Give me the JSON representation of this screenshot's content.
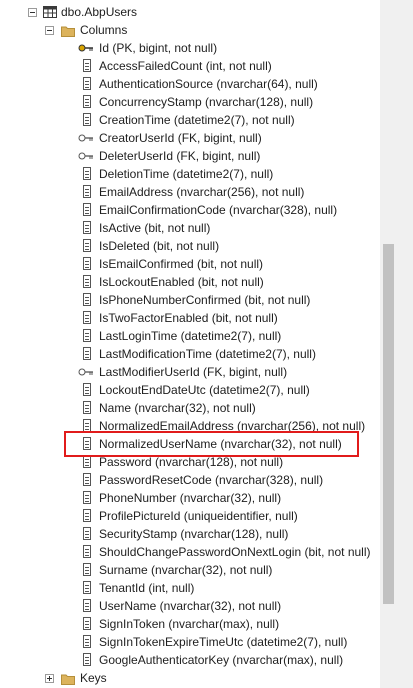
{
  "table": {
    "label": "dbo.AbpUsers",
    "icon": "table-icon"
  },
  "columns_folder": {
    "label": "Columns",
    "icon": "folder-icon"
  },
  "keys_folder": {
    "label": "Keys",
    "icon": "folder-icon"
  },
  "columns": [
    {
      "label": "Id (PK, bigint, not null)",
      "icon": "primary-key-icon"
    },
    {
      "label": "AccessFailedCount (int, not null)",
      "icon": "column-icon"
    },
    {
      "label": "AuthenticationSource (nvarchar(64), null)",
      "icon": "column-icon"
    },
    {
      "label": "ConcurrencyStamp (nvarchar(128), null)",
      "icon": "column-icon"
    },
    {
      "label": "CreationTime (datetime2(7), not null)",
      "icon": "column-icon"
    },
    {
      "label": "CreatorUserId (FK, bigint, null)",
      "icon": "foreign-key-icon"
    },
    {
      "label": "DeleterUserId (FK, bigint, null)",
      "icon": "foreign-key-icon"
    },
    {
      "label": "DeletionTime (datetime2(7), null)",
      "icon": "column-icon"
    },
    {
      "label": "EmailAddress (nvarchar(256), not null)",
      "icon": "column-icon"
    },
    {
      "label": "EmailConfirmationCode (nvarchar(328), null)",
      "icon": "column-icon"
    },
    {
      "label": "IsActive (bit, not null)",
      "icon": "column-icon"
    },
    {
      "label": "IsDeleted (bit, not null)",
      "icon": "column-icon"
    },
    {
      "label": "IsEmailConfirmed (bit, not null)",
      "icon": "column-icon"
    },
    {
      "label": "IsLockoutEnabled (bit, not null)",
      "icon": "column-icon"
    },
    {
      "label": "IsPhoneNumberConfirmed (bit, not null)",
      "icon": "column-icon"
    },
    {
      "label": "IsTwoFactorEnabled (bit, not null)",
      "icon": "column-icon"
    },
    {
      "label": "LastLoginTime (datetime2(7), null)",
      "icon": "column-icon"
    },
    {
      "label": "LastModificationTime (datetime2(7), null)",
      "icon": "column-icon"
    },
    {
      "label": "LastModifierUserId (FK, bigint, null)",
      "icon": "foreign-key-icon"
    },
    {
      "label": "LockoutEndDateUtc (datetime2(7), null)",
      "icon": "column-icon"
    },
    {
      "label": "Name (nvarchar(32), not null)",
      "icon": "column-icon"
    },
    {
      "label": "NormalizedEmailAddress (nvarchar(256), not null)",
      "icon": "column-icon"
    },
    {
      "label": "NormalizedUserName (nvarchar(32), not null)",
      "icon": "column-icon",
      "highlighted": true
    },
    {
      "label": "Password (nvarchar(128), not null)",
      "icon": "column-icon"
    },
    {
      "label": "PasswordResetCode (nvarchar(328), null)",
      "icon": "column-icon"
    },
    {
      "label": "PhoneNumber (nvarchar(32), null)",
      "icon": "column-icon"
    },
    {
      "label": "ProfilePictureId (uniqueidentifier, null)",
      "icon": "column-icon"
    },
    {
      "label": "SecurityStamp (nvarchar(128), null)",
      "icon": "column-icon"
    },
    {
      "label": "ShouldChangePasswordOnNextLogin (bit, not null)",
      "icon": "column-icon"
    },
    {
      "label": "Surname (nvarchar(32), not null)",
      "icon": "column-icon"
    },
    {
      "label": "TenantId (int, null)",
      "icon": "column-icon"
    },
    {
      "label": "UserName (nvarchar(32), not null)",
      "icon": "column-icon"
    },
    {
      "label": "SignInToken (nvarchar(max), null)",
      "icon": "column-icon"
    },
    {
      "label": "SignInTokenExpireTimeUtc (datetime2(7), null)",
      "icon": "column-icon"
    },
    {
      "label": "GoogleAuthenticatorKey (nvarchar(max), null)",
      "icon": "column-icon"
    }
  ],
  "colors": {
    "highlight": "#e11b1b",
    "folder": "#dcb35c",
    "table": "#3a3a3a"
  }
}
